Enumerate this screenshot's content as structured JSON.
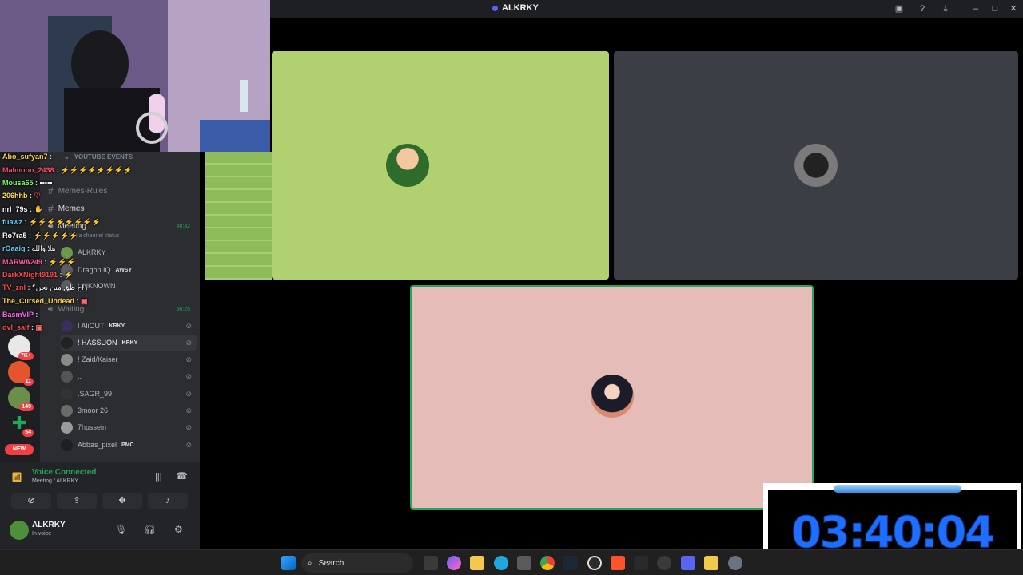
{
  "window": {
    "title": "ALKRKY"
  },
  "channels": {
    "header": "YOUTUBE EVENTS",
    "text_channels": [
      {
        "name": "Memes-Rules",
        "active": false
      },
      {
        "name": "Memes",
        "active": true
      }
    ],
    "voice_meeting": {
      "name": "Meeting",
      "timer": "48:32",
      "status": "Set a channel status",
      "users": [
        "ALKRKY",
        "Dragon IQ",
        "UNKNOWN"
      ],
      "user_tag": "AWSY"
    },
    "voice_waiting": {
      "name": "Waiting",
      "timer": "56:25",
      "users": [
        {
          "name": "! AliOUT",
          "tag": "KRKY"
        },
        {
          "name": "! HASSUON",
          "tag": "KRKY"
        },
        {
          "name": "! Zaid/Kaiser",
          "tag": ""
        },
        {
          "name": "..",
          "tag": ""
        },
        {
          "name": ".SAGR_99",
          "tag": ""
        },
        {
          "name": "3moor 26",
          "tag": ""
        },
        {
          "name": "7hussein",
          "tag": ""
        },
        {
          "name": "Abbas_pixel",
          "tag": "PMC"
        }
      ]
    }
  },
  "guilds": {
    "badges": [
      "7K+",
      "11",
      "149",
      "54"
    ],
    "new_label": "NEW"
  },
  "voice_panel": {
    "status": "Voice Connected",
    "channel": "Meeting / ALKRKY"
  },
  "user_panel": {
    "name": "ALKRKY",
    "status": "In voice"
  },
  "chat": [
    {
      "user": "Abo_sufyan7",
      "color": "#ffd24a",
      "msg": ""
    },
    {
      "user": "Malmoon_2438",
      "color": "#ff4a6e",
      "msg": ""
    },
    {
      "user": "Mousa65",
      "color": "#7dff6a",
      "msg": ""
    },
    {
      "user": "206hhb",
      "color": "#ffe14a",
      "msg": ""
    },
    {
      "user": "nrl_79s",
      "color": "#ffffff",
      "msg": ""
    },
    {
      "user": "fuawz",
      "color": "#5fd3ff",
      "msg": ""
    },
    {
      "user": "Ro7ra5",
      "color": "#ffffff",
      "msg": ""
    },
    {
      "user": "rOaaiq",
      "color": "#5fd3ff",
      "msg": "هلا والله"
    },
    {
      "user": "MARWA249",
      "color": "#ff5aa0",
      "msg": ""
    },
    {
      "user": "DarkXNight9191",
      "color": "#ff4a4a",
      "msg": ""
    },
    {
      "user": "TV_znl",
      "color": "#ff4a4a",
      "msg": "راح طق مين نحن؟"
    },
    {
      "user": "The_Cursed_Undead",
      "color": "#ffd24a",
      "msg": ""
    },
    {
      "user": "BasmVIP",
      "color": "#ff6af0",
      "msg": ""
    },
    {
      "user": "dvl_salf",
      "color": "#ff4a4a",
      "msg": ""
    }
  ],
  "clock": {
    "time": "03:40:04"
  },
  "taskbar": {
    "search_label": "Search"
  },
  "colors": {
    "speaking_border": "#23a55a",
    "clock_digits": "#1e6fff",
    "tile_green": "#b1d070",
    "tile_grey": "#3b3e45",
    "tile_pink": "#e5bcb8"
  }
}
